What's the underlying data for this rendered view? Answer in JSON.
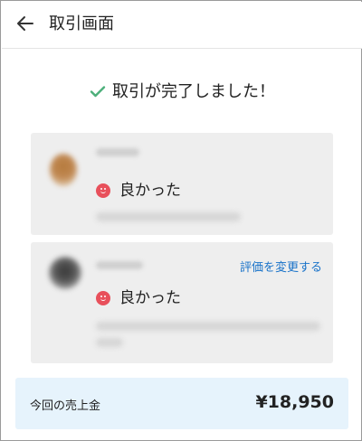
{
  "header": {
    "title": "取引画面"
  },
  "status": {
    "message": "取引が完了しました！"
  },
  "reviews": [
    {
      "rating_label": "良かった"
    },
    {
      "rating_label": "良かった",
      "action_label": "評価を変更する"
    }
  ],
  "sales": {
    "label": "今回の売上金",
    "amount": "¥18,950"
  },
  "colors": {
    "accent": "#1a73c9",
    "check": "#4caf7a",
    "good_face": "#e8505b",
    "sales_bg": "#e6f3fc"
  }
}
